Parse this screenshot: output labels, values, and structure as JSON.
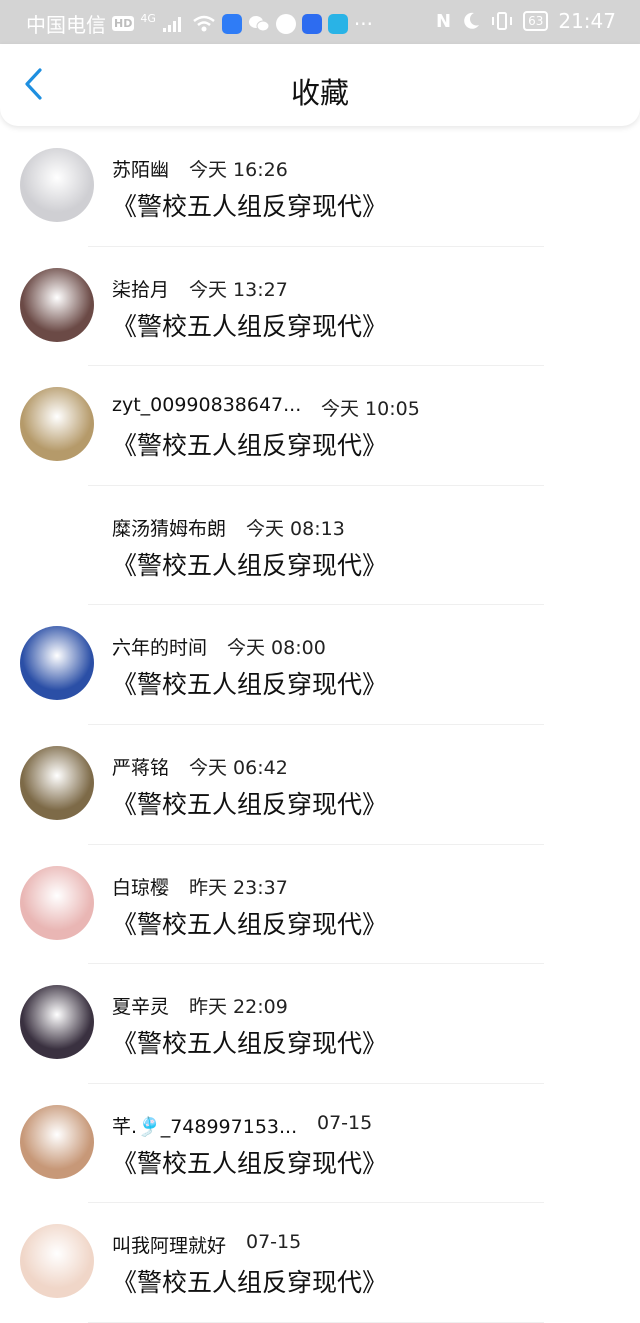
{
  "status_bar": {
    "carrier": "中国电信",
    "hd_badge": "HD",
    "network": "4G",
    "battery": "63",
    "time": "21:47",
    "more": "···"
  },
  "header": {
    "title": "收藏",
    "back_icon": "chevron-left-icon"
  },
  "items": [
    {
      "name": "苏陌幽",
      "time": "今天 16:26",
      "book": "《警校五人组反穿现代》",
      "avatar_color": "#cfcfd3"
    },
    {
      "name": "柒拾月",
      "time": "今天 13:27",
      "book": "《警校五人组反穿现代》",
      "avatar_color": "#6b4a46"
    },
    {
      "name": "zyt_00990838647...",
      "time": "今天 10:05",
      "book": "《警校五人组反穿现代》",
      "avatar_color": "#b59a6a"
    },
    {
      "name": "糜汤猜姆布朗",
      "time": "今天 08:13",
      "book": "《警校五人组反穿现代》",
      "avatar_color": "#ffffff"
    },
    {
      "name": "六年的时间",
      "time": "今天 08:00",
      "book": "《警校五人组反穿现代》",
      "avatar_color": "#2b4fa6"
    },
    {
      "name": "严蒋铭",
      "time": "今天 06:42",
      "book": "《警校五人组反穿现代》",
      "avatar_color": "#7d6a48"
    },
    {
      "name": "白琼樱",
      "time": "昨天 23:37",
      "book": "《警校五人组反穿现代》",
      "avatar_color": "#e9b6b4"
    },
    {
      "name": "夏辛灵",
      "time": "昨天 22:09",
      "book": "《警校五人组反穿现代》",
      "avatar_color": "#3a3140"
    },
    {
      "name": "芊.🎐_748997153...",
      "time": "07-15",
      "book": "《警校五人组反穿现代》",
      "avatar_color": "#c79878"
    },
    {
      "name": "叫我阿理就好",
      "time": "07-15",
      "book": "《警校五人组反穿现代》",
      "avatar_color": "#f0d6c8"
    }
  ]
}
